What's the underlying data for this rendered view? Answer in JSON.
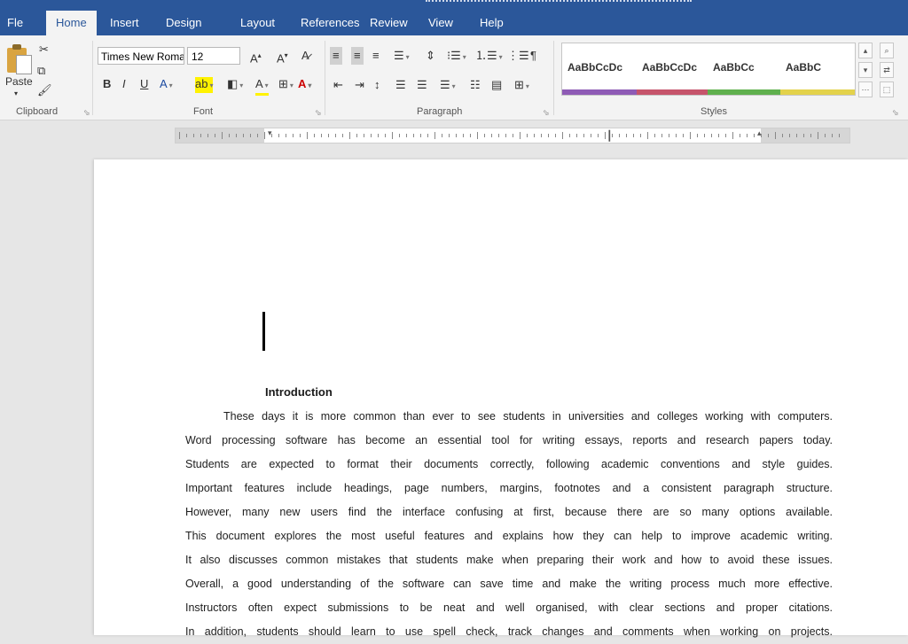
{
  "tabs": [
    {
      "label": "Fle",
      "active": false
    },
    {
      "label": "Home",
      "active": true
    },
    {
      "label": "Insert",
      "active": false
    },
    {
      "label": "Design",
      "active": false
    },
    {
      "label": "Layout",
      "active": false
    },
    {
      "label": "References",
      "active": false
    },
    {
      "label": "Review",
      "active": false
    },
    {
      "label": "View",
      "active": false
    },
    {
      "label": "Help",
      "active": false
    }
  ],
  "clipboard": {
    "paste_label": "Paste",
    "group_label": "Clipboard"
  },
  "font": {
    "name": "Times New Roman",
    "size": "12",
    "group_label": "Font"
  },
  "paragraph": {
    "group_label": "Paragraph"
  },
  "styles": {
    "group_label": "Styles",
    "items": [
      {
        "label": "AaBbCcDc",
        "color": "#8e5bb5"
      },
      {
        "label": "AaBbCcDc",
        "color": "#c6546b"
      },
      {
        "label": "AaBbCc",
        "color": "#5fb04d"
      },
      {
        "label": "AaBbC",
        "color": "#e3d24b"
      }
    ]
  },
  "document": {
    "heading": "Introduction",
    "lines": [
      "These days it is more common than ever to see students in universities and colleges working with computers.",
      "Word processing software has become an essential tool for writing essays, reports and research papers today.",
      "Students are expected to format their documents correctly, following academic conventions and style guides.",
      "Important features include headings, page numbers, margins, footnotes and a consistent paragraph structure.",
      "However, many new users find the interface confusing at first, because there are so many options available.",
      "This document explores the most useful features and explains how they can help to improve academic writing.",
      "It also discusses common mistakes that students make when preparing their work and how to avoid these issues.",
      "Overall, a good understanding of the software can save time and make the writing process much more effective.",
      "Instructors often expect submissions to be neat and well organised, with clear sections and proper citations.",
      "In addition, students should learn to use spell check, track changes and comments when working on projects."
    ]
  }
}
